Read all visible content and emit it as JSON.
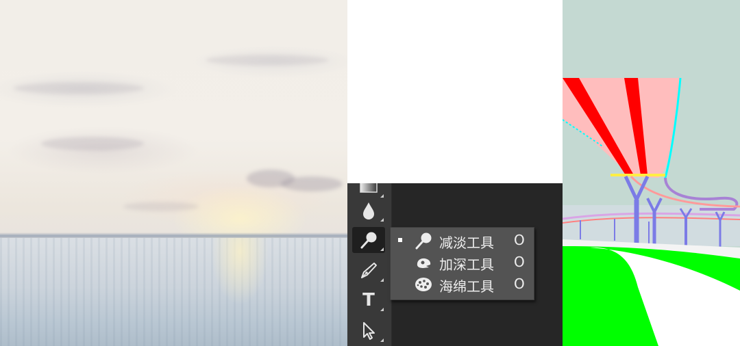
{
  "panels": {
    "painting": {
      "description_colors": {
        "sky": "#f2eee8",
        "water": "#c8d2db"
      }
    },
    "toolbar": {
      "tools": [
        {
          "name": "gradient-tool",
          "active": false
        },
        {
          "name": "blur-tool",
          "active": false
        },
        {
          "name": "dodge-tool",
          "active": true
        },
        {
          "name": "pen-tool",
          "active": false
        },
        {
          "name": "type-tool",
          "active": false,
          "glyph": "T"
        },
        {
          "name": "path-selection-tool",
          "active": false
        }
      ]
    },
    "flyout": {
      "items": [
        {
          "label": "减淡工具",
          "shortcut": "O",
          "icon": "dodge-icon",
          "selected": true
        },
        {
          "label": "加深工具",
          "shortcut": "O",
          "icon": "burn-icon",
          "selected": false
        },
        {
          "label": "海绵工具",
          "shortcut": "O",
          "icon": "sponge-icon",
          "selected": false
        }
      ]
    },
    "render": {
      "colors": {
        "sky": "#c4d9d2",
        "canopy": "#ffb8b8",
        "beam": "#ff0000",
        "column": "#7b7be6",
        "grass": "#00ff00",
        "road": "#ffffff",
        "edge": "#00ffff",
        "band": "#ffee44"
      }
    }
  }
}
